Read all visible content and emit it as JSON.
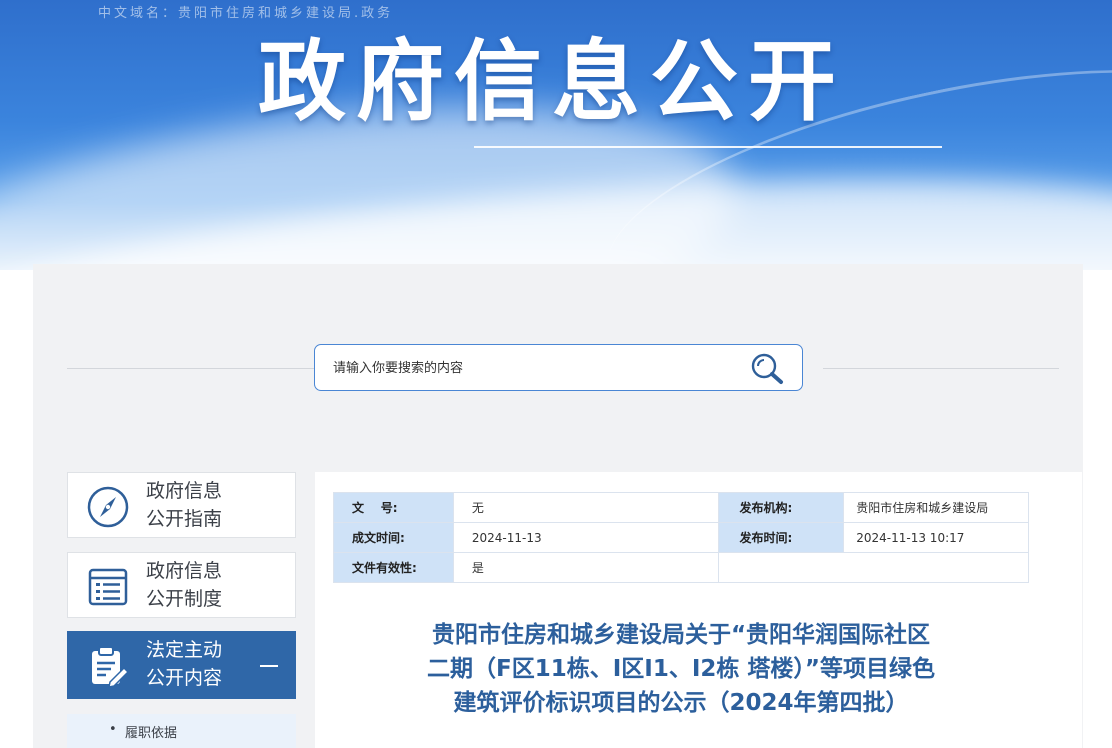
{
  "header": {
    "domain_label": "中文域名：贵阳市住房和城乡建设局.政务",
    "title": "政府信息公开"
  },
  "search": {
    "placeholder": "请输入你要搜索的内容"
  },
  "sidebar": {
    "items": [
      {
        "line1": "政府信息",
        "line2": "公开指南",
        "icon": "compass-icon",
        "active": false
      },
      {
        "line1": "政府信息",
        "line2": "公开制度",
        "icon": "list-document-icon",
        "active": false
      },
      {
        "line1": "法定主动",
        "line2": "公开内容",
        "icon": "clipboard-edit-icon",
        "active": true
      }
    ],
    "subitems": [
      "履职依据"
    ]
  },
  "meta": {
    "doc_number_label": "文    号:",
    "doc_number": "无",
    "publisher_label": "发布机构:",
    "publisher": "贵阳市住房和城乡建设局",
    "written_date_label": "成文时间:",
    "written_date": "2024-11-13",
    "publish_time_label": "发布时间:",
    "publish_time": "2024-11-13 10:17",
    "validity_label": "文件有效性:",
    "validity": "是"
  },
  "document": {
    "title_line1": "贵阳市住房和城乡建设局关于“贵阳华润国际社区",
    "title_line2": "二期（F区11栋、I区I1、I2栋 塔楼）”等项目绿色",
    "title_line3": "建筑评价标识项目的公示（2024年第四批）"
  },
  "colors": {
    "banner_blue": "#3b84dd",
    "active_nav": "#2f67a8",
    "title_blue": "#2c5f9c",
    "table_header": "#cfe2f7"
  }
}
